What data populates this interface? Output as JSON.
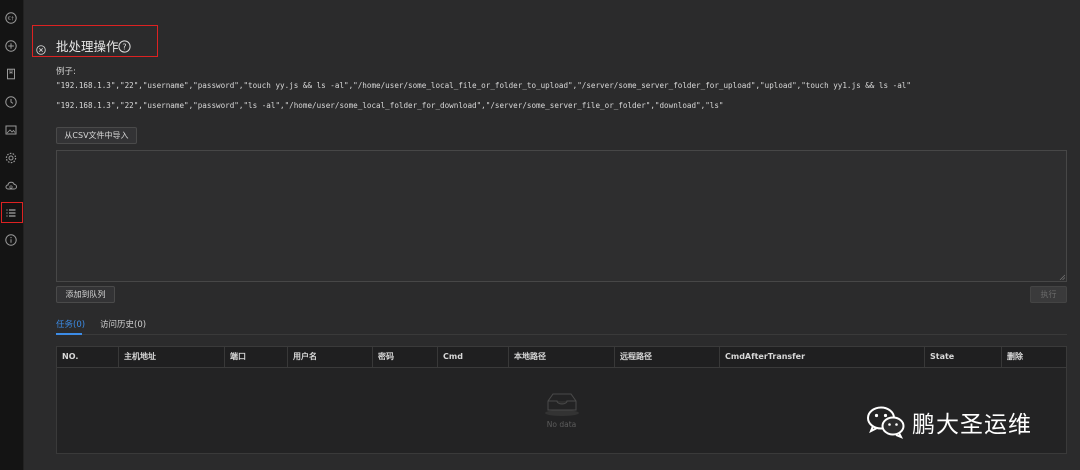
{
  "sidebar": {
    "icons": [
      "terminal-icon",
      "add-circle-icon",
      "bookmark-icon",
      "history-icon",
      "image-icon",
      "gear-icon",
      "cloud-sync-icon",
      "list-icon",
      "info-icon"
    ],
    "active": "list-icon"
  },
  "header": {
    "title": "批处理操作",
    "help_icon": "?"
  },
  "example": {
    "label": "例子:",
    "lines": [
      "\"192.168.1.3\",\"22\",\"username\",\"password\",\"touch yy.js && ls -al\",\"/home/user/some_local_file_or_folder_to_upload\",\"/server/some_server_folder_for_upload\",\"upload\",\"touch yy1.js && ls -al\"",
      "\"192.168.1.3\",\"22\",\"username\",\"password\",\"ls -al\",\"/home/user/some_local_folder_for_download\",\"/server/some_server_file_or_folder\",\"download\",\"ls\""
    ]
  },
  "buttons": {
    "import_csv": "从CSV文件中导入",
    "add_to_queue": "添加到队列",
    "execute": "执行"
  },
  "input": {
    "value": ""
  },
  "tabs": [
    {
      "label": "任务(0)",
      "active": true
    },
    {
      "label": "访问历史(0)",
      "active": false
    }
  ],
  "table": {
    "columns": [
      "NO.",
      "主机地址",
      "端口",
      "用户名",
      "密码",
      "Cmd",
      "本地路径",
      "远程路径",
      "CmdAfterTransfer",
      "State",
      "删除"
    ],
    "rows": [],
    "empty_text": "No data"
  },
  "watermark": {
    "text": "鹏大圣运维"
  },
  "colors": {
    "background": "#2b2b2c",
    "sidebar": "#141414",
    "highlight_box": "#dd2222",
    "accent": "#3c8ce7"
  }
}
